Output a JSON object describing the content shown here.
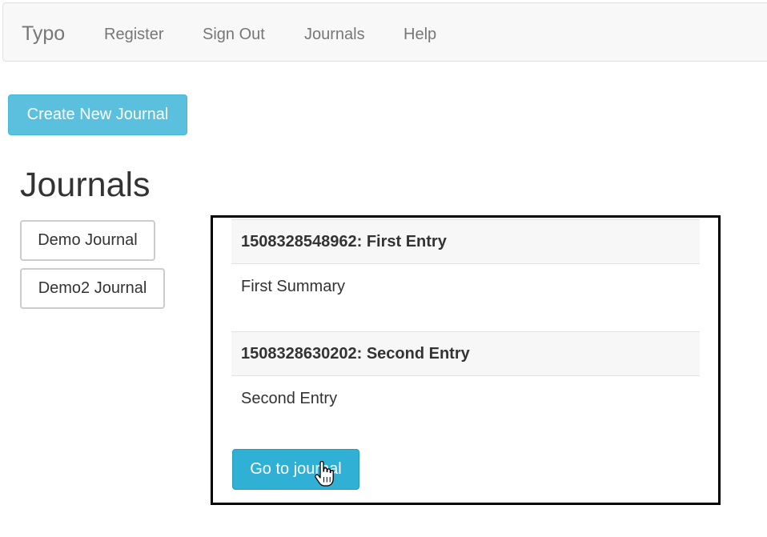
{
  "navbar": {
    "brand": "Typo",
    "links": [
      "Register",
      "Sign Out",
      "Journals",
      "Help"
    ]
  },
  "create_button": "Create New Journal",
  "page_title": "Journals",
  "journals": [
    "Demo Journal",
    "Demo2 Journal"
  ],
  "popup": {
    "entries": [
      {
        "header": "1508328548962: First Entry",
        "summary": "First Summary"
      },
      {
        "header": "1508328630202: Second Entry",
        "summary": "Second Entry"
      }
    ],
    "go_button": "Go to journal"
  },
  "icons": {
    "cursor": "hand-pointer-icon"
  },
  "colors": {
    "info": "#5bc0de",
    "info_active": "#31b0d5",
    "navbar_bg": "#f8f8f8",
    "nav_text": "#777777"
  }
}
